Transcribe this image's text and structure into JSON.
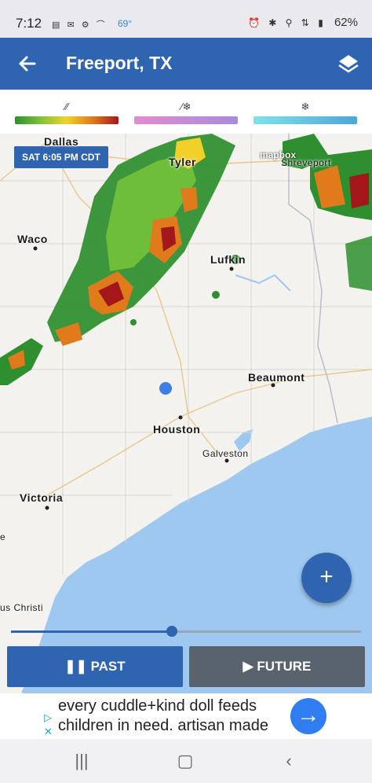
{
  "status_bar": {
    "time": "7:12",
    "left_icons": "▤ ✉ ⚙ ⌒",
    "temperature": "69°",
    "system_icons": "⏰ ✱ ⚲ ⇅ ▮",
    "battery": "62%"
  },
  "app_bar": {
    "title": "Freeport, TX"
  },
  "legend": [
    {
      "kind": "rain",
      "icon": "⁄⁄",
      "gradient": "linear-gradient(90deg,#2d8f2d,#7fc43a,#f2d02a,#e07b1c,#a3171a)"
    },
    {
      "kind": "mix",
      "icon": "⁄❄",
      "gradient": "linear-gradient(90deg,#e58bcf,#a78be0)"
    },
    {
      "kind": "snow",
      "icon": "❄",
      "gradient": "linear-gradient(90deg,#7fe3ea,#4ca6d8)"
    }
  ],
  "map": {
    "timestamp": "SAT 6:05 PM CDT",
    "attribution": "mapbox",
    "cities": [
      "Dallas",
      "Tyler",
      "Shreveport",
      "Waco",
      "Lufkin",
      "Beaumont",
      "Houston",
      "Galveston",
      "Victoria",
      "us Christi",
      "e"
    ]
  },
  "timeline": {
    "position_fraction": 0.46,
    "past_label": "PAST",
    "future_label": "FUTURE"
  },
  "ad": {
    "line1": "every cuddle+kind doll feeds",
    "line2": "children in need. artisan made",
    "cta_icon": "arrow-right"
  },
  "colors": {
    "accent": "#2f64b0",
    "future_button": "#59636e",
    "water": "#9ec8f0",
    "land": "#f3f2ee"
  }
}
